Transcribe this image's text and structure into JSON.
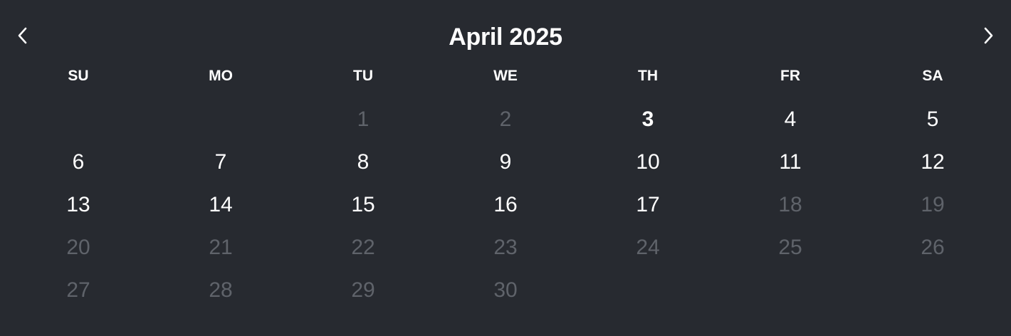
{
  "calendar": {
    "title": "April 2025",
    "prev_icon": "chevron-left-icon",
    "next_icon": "chevron-right-icon",
    "weekdays": [
      "SU",
      "MO",
      "TU",
      "WE",
      "TH",
      "FR",
      "SA"
    ],
    "weeks": [
      [
        null,
        null,
        {
          "day": "1",
          "disabled": true
        },
        {
          "day": "2",
          "disabled": true
        },
        {
          "day": "3",
          "today": true
        },
        {
          "day": "4"
        },
        {
          "day": "5"
        }
      ],
      [
        {
          "day": "6"
        },
        {
          "day": "7"
        },
        {
          "day": "8"
        },
        {
          "day": "9"
        },
        {
          "day": "10"
        },
        {
          "day": "11"
        },
        {
          "day": "12"
        }
      ],
      [
        {
          "day": "13"
        },
        {
          "day": "14"
        },
        {
          "day": "15"
        },
        {
          "day": "16"
        },
        {
          "day": "17"
        },
        {
          "day": "18",
          "disabled": true
        },
        {
          "day": "19",
          "disabled": true
        }
      ],
      [
        {
          "day": "20",
          "disabled": true
        },
        {
          "day": "21",
          "disabled": true
        },
        {
          "day": "22",
          "disabled": true
        },
        {
          "day": "23",
          "disabled": true
        },
        {
          "day": "24",
          "disabled": true
        },
        {
          "day": "25",
          "disabled": true
        },
        {
          "day": "26",
          "disabled": true
        }
      ],
      [
        {
          "day": "27",
          "disabled": true
        },
        {
          "day": "28",
          "disabled": true
        },
        {
          "day": "29",
          "disabled": true
        },
        {
          "day": "30",
          "disabled": true
        },
        null,
        null,
        null
      ]
    ],
    "colors": {
      "background": "#272a30",
      "text": "#ffffff",
      "disabled_text": "#5f636a"
    }
  }
}
